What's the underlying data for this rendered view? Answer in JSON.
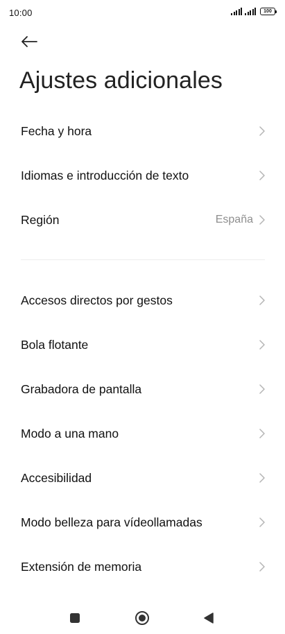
{
  "status_bar": {
    "time": "10:00",
    "battery": "100"
  },
  "header": {
    "back_icon": "arrow-left-icon",
    "title": "Ajustes adicionales"
  },
  "section_1": [
    {
      "label": "Fecha y hora",
      "value": ""
    },
    {
      "label": "Idiomas e introducción de texto",
      "value": ""
    },
    {
      "label": "Región",
      "value": "España"
    }
  ],
  "section_2": [
    {
      "label": "Accesos directos por gestos"
    },
    {
      "label": "Bola flotante"
    },
    {
      "label": "Grabadora de pantalla"
    },
    {
      "label": "Modo a una mano"
    },
    {
      "label": "Accesibilidad"
    },
    {
      "label": "Modo belleza para vídeollamadas"
    },
    {
      "label": "Extensión de memoria"
    }
  ],
  "colors": {
    "text": "#111111",
    "secondary_text": "#8e8e8e",
    "chevron": "#b5b5b5",
    "divider": "#ececec"
  }
}
